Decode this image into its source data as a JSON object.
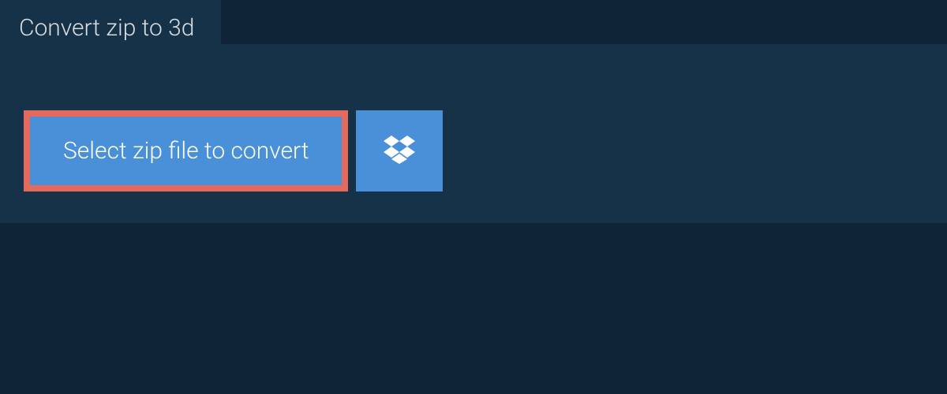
{
  "tab": {
    "label": "Convert zip to 3d"
  },
  "buttons": {
    "select_label": "Select zip file to convert"
  },
  "colors": {
    "background": "#0f2537",
    "panel": "#163248",
    "button": "#4a90d9",
    "highlight_border": "#e36a5c",
    "text_light": "#d9dde0",
    "text_white": "#ffffff"
  }
}
